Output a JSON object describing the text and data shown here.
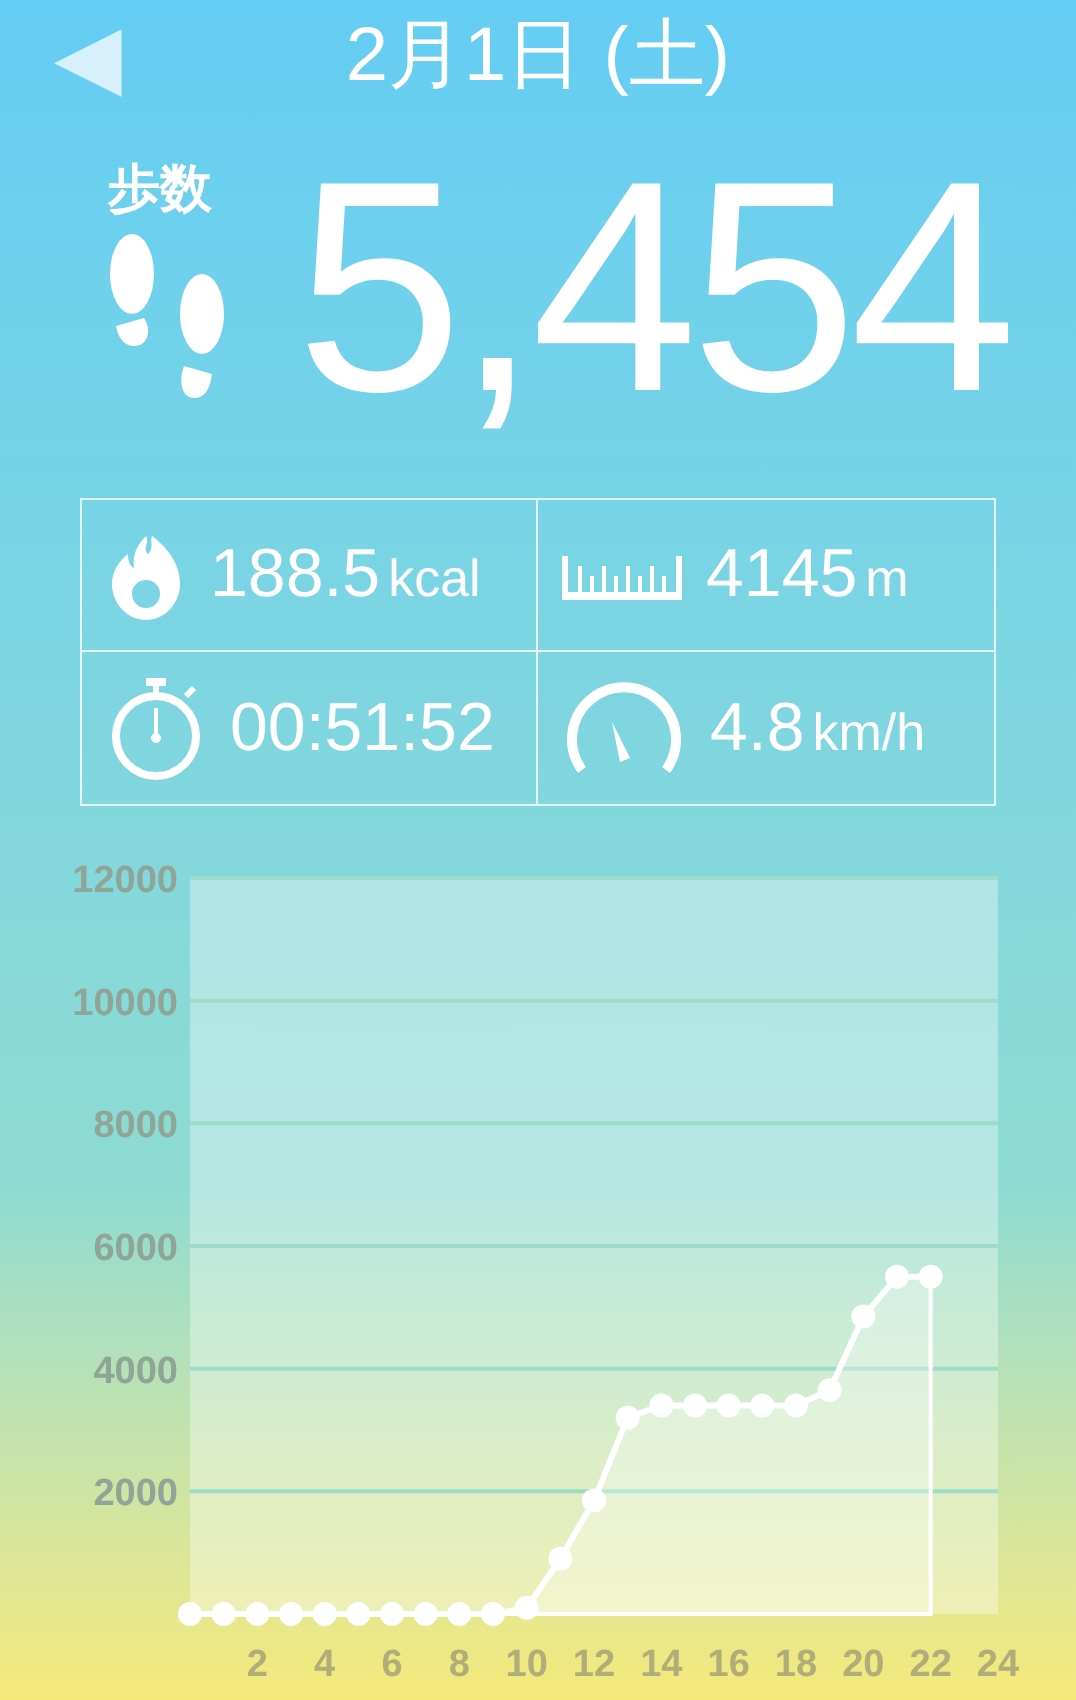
{
  "header": {
    "back": "◀",
    "title": "2月1日 (土)"
  },
  "steps": {
    "label": "歩数",
    "value": "5,454"
  },
  "stats": [
    {
      "kind": "calories",
      "value": "188.5",
      "unit": "kcal"
    },
    {
      "kind": "distance",
      "value": "4145",
      "unit": "m"
    },
    {
      "kind": "time",
      "value": "00:51:52"
    },
    {
      "kind": "speed",
      "value": "4.8",
      "unit": "km/h"
    }
  ],
  "chart": {
    "chart_data": {
      "type": "area",
      "x": [
        0,
        1,
        2,
        3,
        4,
        5,
        6,
        7,
        8,
        9,
        10,
        11,
        12,
        13,
        14,
        15,
        16,
        17,
        18,
        19,
        20,
        21,
        22
      ],
      "grid": true,
      "series": [
        {
          "color": "#ffffff",
          "values": [
            0,
            0,
            0,
            0,
            0,
            0,
            0,
            0,
            0,
            0,
            100,
            900,
            1850,
            3200,
            3400,
            3400,
            3400,
            3400,
            3400,
            3650,
            4850,
            5500,
            5500
          ]
        }
      ],
      "xlim": [
        0,
        24
      ],
      "ylim": [
        0,
        12000
      ],
      "xticks": [
        2,
        4,
        6,
        8,
        10,
        12,
        14,
        16,
        18,
        20,
        22,
        24
      ],
      "yticks": [
        2000,
        4000,
        6000,
        8000,
        10000,
        12000
      ]
    }
  }
}
